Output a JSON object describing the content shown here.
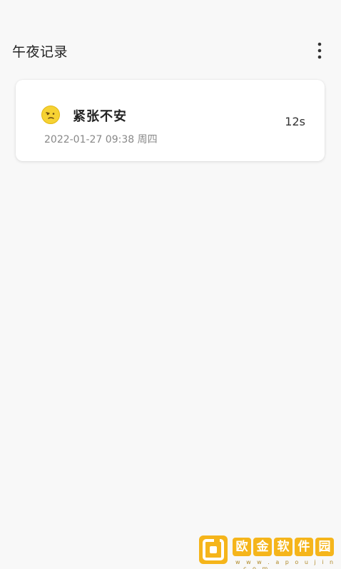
{
  "app_bar": {
    "title": "午夜记录",
    "menu_icon": "more-vertical-icon"
  },
  "records": [
    {
      "mood": "紧张不安",
      "mood_icon": "worried-face-icon",
      "datetime": "2022-01-27 09:38 周四",
      "duration": "12s"
    }
  ],
  "watermark": {
    "chars": [
      "欧",
      "金",
      "软",
      "件",
      "园"
    ],
    "url": "w w w . a p o u j i n . c o m",
    "logo_icon": "apoujin-logo-icon"
  },
  "colors": {
    "background": "#f8f8f8",
    "card": "#ffffff",
    "mood_icon_yellow": "#f6d233",
    "watermark_yellow": "#f5b51b"
  }
}
